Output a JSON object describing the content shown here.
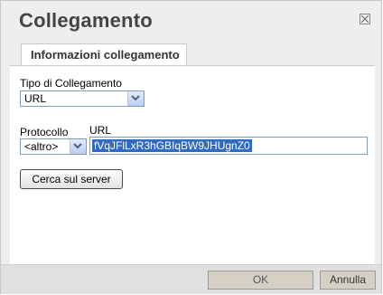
{
  "dialog": {
    "title": "Collegamento",
    "close_icon": "close-box-icon"
  },
  "tabs": [
    {
      "label": "Informazioni collegamento"
    }
  ],
  "link_type": {
    "label": "Tipo di Collegamento",
    "value": "URL"
  },
  "protocol": {
    "label": "Protocollo",
    "value": "<altro>"
  },
  "url": {
    "label": "URL",
    "value": "fVqJFlLxR3hGBIqBW9JHUgnZ0"
  },
  "browse_button": {
    "label": "Cerca sul server"
  },
  "footer": {
    "ok_label": "OK",
    "cancel_label": "Annulla"
  }
}
